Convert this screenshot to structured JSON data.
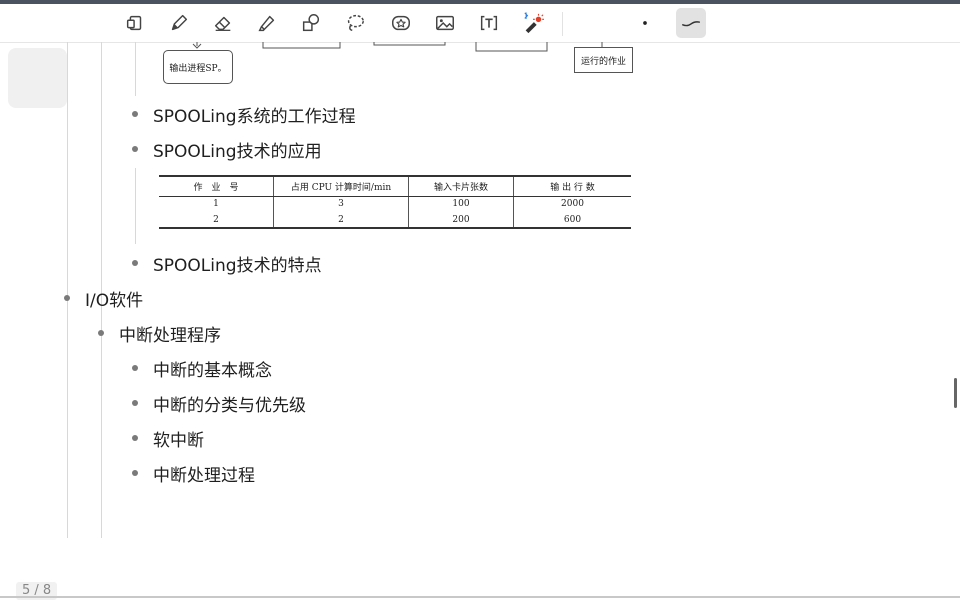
{
  "toolbar": {
    "tools": [
      {
        "icon": "page-switch-icon",
        "name": "tool-page"
      },
      {
        "icon": "pen-icon",
        "name": "tool-pen"
      },
      {
        "icon": "eraser-icon",
        "name": "tool-eraser"
      },
      {
        "icon": "highlighter-icon",
        "name": "tool-highlighter"
      },
      {
        "icon": "shapes-icon",
        "name": "tool-shapes"
      },
      {
        "icon": "lasso-icon",
        "name": "tool-lasso"
      },
      {
        "icon": "sticker-icon",
        "name": "tool-sticker"
      },
      {
        "icon": "image-icon",
        "name": "tool-image"
      },
      {
        "icon": "text-box-icon",
        "name": "tool-text"
      },
      {
        "icon": "laser-pointer-icon",
        "name": "tool-laser"
      },
      {
        "icon": "dot-size-icon",
        "name": "tool-pen-size"
      },
      {
        "icon": "stroke-style-icon",
        "name": "tool-stroke-style"
      }
    ]
  },
  "diagram": {
    "output_process_label": "输出进程SP。",
    "running_job_label": "运行的作业"
  },
  "outline": {
    "spooling_process": "SPOOLing系统的工作过程",
    "spooling_application": "SPOOLing技术的应用",
    "spooling_features": "SPOOLing技术的特点",
    "io_software": "I/O软件",
    "interrupt_handler": "中断处理程序",
    "interrupt_concept": "中断的基本概念",
    "interrupt_classification": "中断的分类与优先级",
    "soft_interrupt": "软中断",
    "interrupt_process": "中断处理过程"
  },
  "job_table": {
    "headers": [
      "作　业　号",
      "占用 CPU 计算时间/min",
      "输入卡片张数",
      "输 出 行 数"
    ],
    "rows": [
      [
        "1",
        "3",
        "100",
        "2000"
      ],
      [
        "2",
        "2",
        "200",
        "600"
      ]
    ]
  },
  "pager": {
    "label": "5 / 8"
  },
  "colors": {
    "top_stripe": "#4b5260",
    "laser_red": "#e0402a",
    "bluetooth_blue": "#2a7de1"
  }
}
